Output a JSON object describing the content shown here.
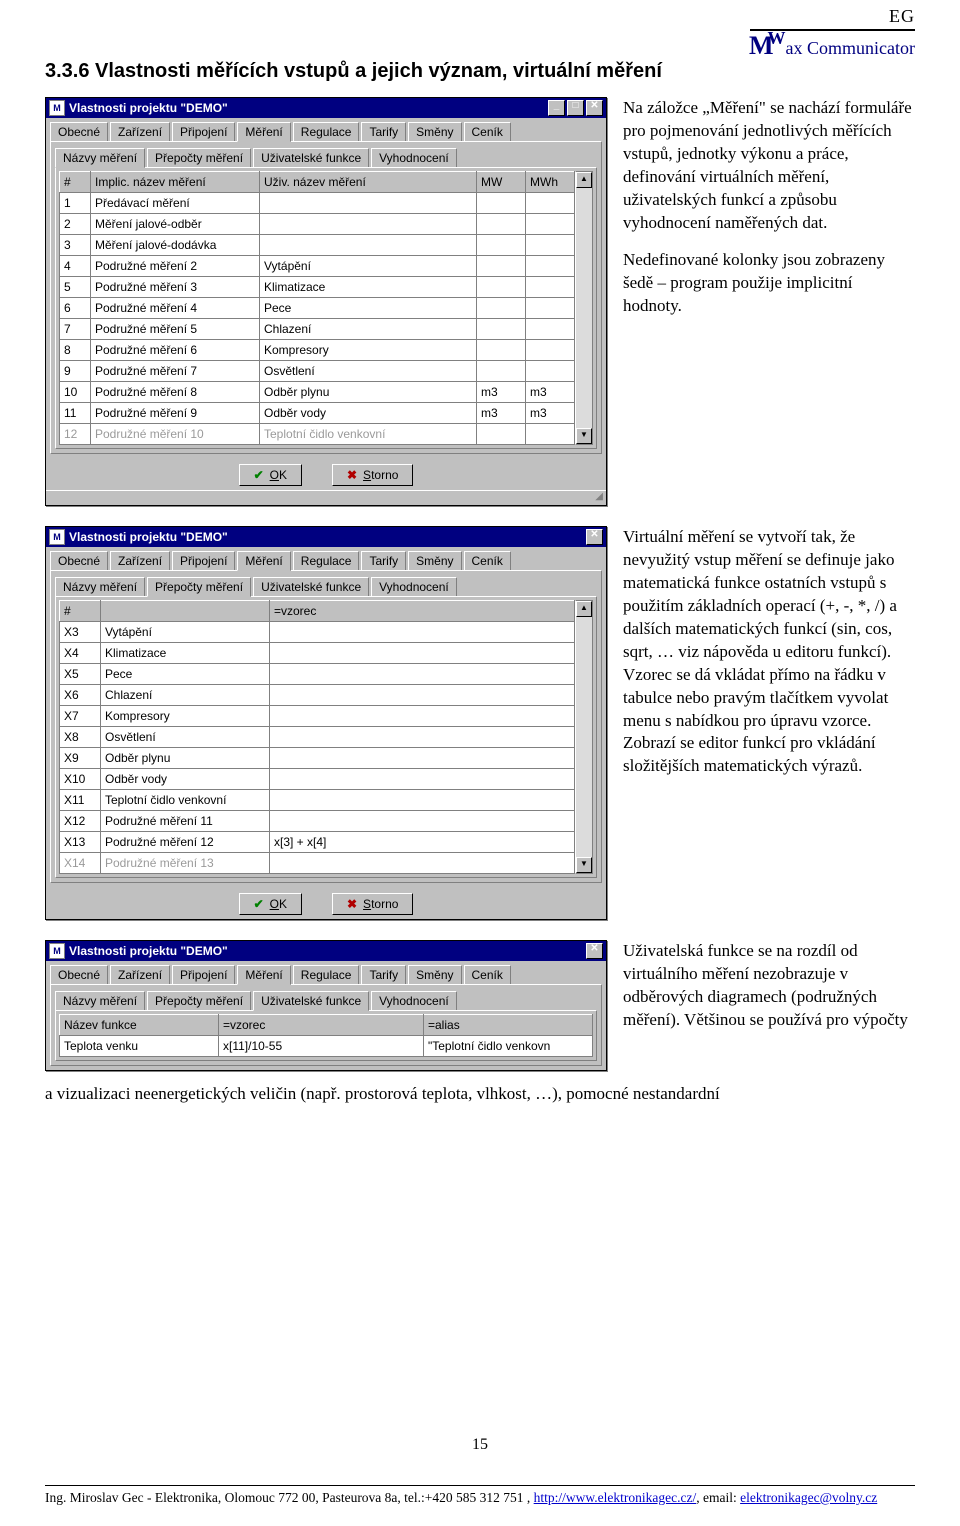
{
  "logo": {
    "eg": "EG",
    "brand_prefix": "M",
    "brand_w": "W",
    "brand_rest": "ax Communicator"
  },
  "section_title": "3.3.6  Vlastnosti měřících vstupů a jejich význam, virtuální měření",
  "para1": "Na záložce „Měření\" se nachází formuláře pro pojmenování jednotlivých měřících vstupů, jednotky výkonu a práce, definování virtuálních měření, uživatelských funkcí a způsobu vyhodnocení naměřených dat.",
  "para2": "Nedefinované kolonky jsou zobrazeny šedě – program použije implicitní hodnoty.",
  "para3": "Virtuální měření se vytvoří tak, že nevyužitý vstup měření se definuje jako matematická funkce ostatních vstupů s použitím základních operací (+, -, *, /) a dalších matematických funkcí (sin, cos, sqrt, … viz nápověda u editoru funkcí). Vzorec se dá vkládat přímo na řádku v tabulce nebo pravým tlačítkem vyvolat menu s nabídkou pro úpravu vzorce. Zobrazí se editor funkcí pro vkládání složitějších matematických výrazů.",
  "para4": "Uživatelská funkce se na rozdíl od virtuálního měření nezobrazuje v odběrových diagramech (podružných měření). Většinou se používá pro výpočty",
  "bridge": "a vizualizaci neenergetických veličin (např. prostorová teplota, vlhkost, …), pomocné nestandardní",
  "page_number": "15",
  "dlg": {
    "title": "Vlastnosti projektu \"DEMO\"",
    "ticon": "M",
    "tabs": [
      "Obecné",
      "Zařízení",
      "Připojení",
      "Měření",
      "Regulace",
      "Tarify",
      "Směny",
      "Ceník"
    ],
    "active_tab": "Měření",
    "subtabs": [
      "Názvy měření",
      "Přepočty měření",
      "Uživatelské funkce",
      "Vyhodnocení"
    ],
    "ok": "OK",
    "storno": "Storno",
    "min": "_",
    "max": "□",
    "close": "✕"
  },
  "tbl1": {
    "headers": [
      "#",
      "Implic. název měření",
      "Uživ. název měření",
      "MW",
      "MWh"
    ],
    "rows": [
      [
        "1",
        "Předávací měření",
        "",
        "",
        ""
      ],
      [
        "2",
        "Měření jalové-odběr",
        "",
        "",
        ""
      ],
      [
        "3",
        "Měření jalové-dodávka",
        "",
        "",
        ""
      ],
      [
        "4",
        "Podružné měření 2",
        "Vytápění",
        "",
        ""
      ],
      [
        "5",
        "Podružné měření 3",
        "Klimatizace",
        "",
        ""
      ],
      [
        "6",
        "Podružné měření 4",
        "Pece",
        "",
        ""
      ],
      [
        "7",
        "Podružné měření 5",
        "Chlazení",
        "",
        ""
      ],
      [
        "8",
        "Podružné měření 6",
        "Kompresory",
        "",
        ""
      ],
      [
        "9",
        "Podružné měření 7",
        "Osvětlení",
        "",
        ""
      ],
      [
        "10",
        "Podružné měření 8",
        "Odběr plynu",
        "m3",
        "m3"
      ],
      [
        "11",
        "Podružné měření 9",
        "Odběr vody",
        "m3",
        "m3"
      ],
      [
        "12",
        "Podružné měření 10",
        "Teplotní čidlo venkovní",
        "",
        ""
      ]
    ]
  },
  "tbl2": {
    "headers": [
      "#",
      "",
      "=vzorec"
    ],
    "rows": [
      [
        "X3",
        "Vytápění",
        ""
      ],
      [
        "X4",
        "Klimatizace",
        ""
      ],
      [
        "X5",
        "Pece",
        ""
      ],
      [
        "X6",
        "Chlazení",
        ""
      ],
      [
        "X7",
        "Kompresory",
        ""
      ],
      [
        "X8",
        "Osvětlení",
        ""
      ],
      [
        "X9",
        "Odběr plynu",
        ""
      ],
      [
        "X10",
        "Odběr vody",
        ""
      ],
      [
        "X11",
        "Teplotní čidlo venkovní",
        ""
      ],
      [
        "X12",
        "Podružné měření 11",
        ""
      ],
      [
        "X13",
        "Podružné měření 12",
        "x[3] + x[4]"
      ],
      [
        "X14",
        "Podružné měření 13",
        ""
      ]
    ]
  },
  "tbl3": {
    "headers": [
      "Název funkce",
      "=vzorec",
      "=alias"
    ],
    "rows": [
      [
        "Teplota venku",
        "x[11]/10-55",
        "\"Teplotní čidlo venkovn"
      ]
    ]
  },
  "footer": {
    "text_a": "Ing. Miroslav Gec - Elektronika, Olomouc 772 00, Pasteurova 8a,  tel.:+420 585 312 751 , ",
    "link1": "http://www.elektronikagec.cz/",
    "text_b": ", email: ",
    "link2": "elektronikagec@volny.cz"
  }
}
